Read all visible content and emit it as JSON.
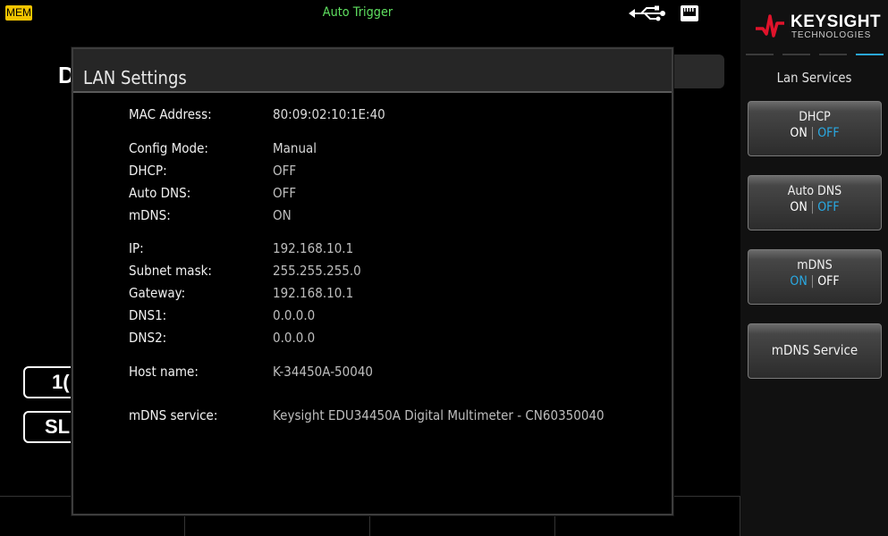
{
  "status_bar": {
    "mem_badge": "MEM",
    "trigger_status": "Auto Trigger",
    "icons": [
      "usb-icon",
      "lan-icon"
    ]
  },
  "background": {
    "title_fragment": "D",
    "range_fragment": "1(",
    "rate_fragment": "SL"
  },
  "dialog": {
    "title": "LAN Settings",
    "fields": {
      "mac_label": "MAC Address:",
      "mac_value": "80:09:02:10:1E:40",
      "config_mode_label": "Config Mode:",
      "config_mode_value": "Manual",
      "dhcp_label": "DHCP:",
      "dhcp_value": "OFF",
      "auto_dns_label": "Auto DNS:",
      "auto_dns_value": "OFF",
      "mdns_label": "mDNS:",
      "mdns_value": "ON",
      "ip_label": "IP:",
      "ip_value": "192.168.10.1",
      "subnet_label": "Subnet mask:",
      "subnet_value": "255.255.255.0",
      "gateway_label": "Gateway:",
      "gateway_value": "192.168.10.1",
      "dns1_label": "DNS1:",
      "dns1_value": "0.0.0.0",
      "dns2_label": "DNS2:",
      "dns2_value": "0.0.0.0",
      "host_label": "Host name:",
      "host_value": "K-34450A-50040",
      "mdns_service_label": "mDNS service:",
      "mdns_service_value": "Keysight EDU34450A Digital Multimeter  - CN60350040"
    }
  },
  "side_panel": {
    "logo_word": "KEYSIGHT",
    "logo_sub": "TECHNOLOGIES",
    "menu_title": "Lan Services",
    "softkeys": {
      "dhcp": {
        "label": "DHCP",
        "on": "ON",
        "off": "OFF",
        "selected": "OFF"
      },
      "auto_dns": {
        "label": "Auto DNS",
        "on": "ON",
        "off": "OFF",
        "selected": "OFF"
      },
      "mdns": {
        "label": "mDNS",
        "on": "ON",
        "off": "OFF",
        "selected": "ON"
      },
      "mdns_service": {
        "label": "mDNS Service"
      }
    },
    "accent_color": "#29a9e3",
    "logo_color": "#e0132b"
  },
  "colors": {
    "mem_badge": "#f3c400",
    "trigger_status": "#5fe060"
  }
}
